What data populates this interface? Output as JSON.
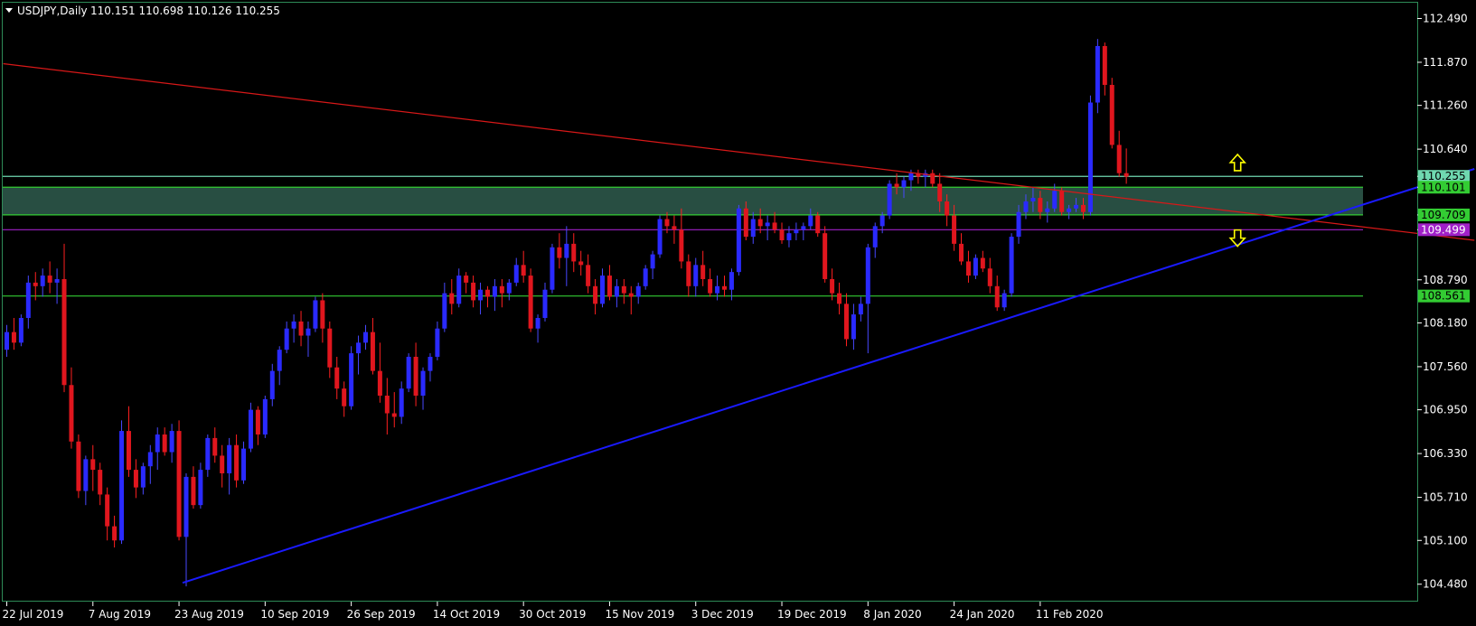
{
  "header": {
    "symbol_timeframe": "USDJPY,Daily",
    "ohlc": "110.151 110.698 110.126 110.255"
  },
  "colors": {
    "background": "#000000",
    "frame": "#2e8b57",
    "bull_candle": "#2a2aff",
    "bear_candle": "#e0161e",
    "bull_wick": "#4848ff",
    "bear_wick": "#ff2020",
    "zone_fill": "#2f5c4e",
    "support_line": "#33cc33",
    "purple_line": "#a020c8",
    "ask_line": "#6fd8b0",
    "blue_trendline": "#1a1aff",
    "red_trendline": "#d81818",
    "arrows": "#ffff00",
    "axis_text": "#ffffff"
  },
  "chart_data": {
    "type": "candlestick",
    "title": "USDJPY,Daily",
    "ylim": [
      104.24,
      112.72
    ],
    "y_ticks": [
      "112.490",
      "111.870",
      "111.260",
      "110.640",
      "110.255",
      "110.101",
      "109.709",
      "109.499",
      "108.790",
      "108.180",
      "107.560",
      "106.950",
      "106.330",
      "105.710",
      "105.100",
      "104.480"
    ],
    "x_ticks": [
      {
        "label": "22 Jul 2019",
        "index": 0
      },
      {
        "label": "7 Aug 2019",
        "index": 12
      },
      {
        "label": "23 Aug 2019",
        "index": 24
      },
      {
        "label": "10 Sep 2019",
        "index": 36
      },
      {
        "label": "26 Sep 2019",
        "index": 48
      },
      {
        "label": "14 Oct 2019",
        "index": 60
      },
      {
        "label": "30 Oct 2019",
        "index": 72
      },
      {
        "label": "15 Nov 2019",
        "index": 84
      },
      {
        "label": "3 Dec 2019",
        "index": 96
      },
      {
        "label": "19 Dec 2019",
        "index": 108
      },
      {
        "label": "8 Jan 2020",
        "index": 120
      },
      {
        "label": "24 Jan 2020",
        "index": 132
      },
      {
        "label": "11 Feb 2020",
        "index": 144
      }
    ],
    "price_labels": [
      {
        "text": "110.255",
        "value": 110.255,
        "color": "#6fd8b0",
        "text_color": "#000000"
      },
      {
        "text": "110.101",
        "value": 110.101,
        "color": "#33cc33",
        "text_color": "#000000"
      },
      {
        "text": "109.709",
        "value": 109.709,
        "color": "#33cc33",
        "text_color": "#000000"
      },
      {
        "text": "109.499",
        "value": 109.499,
        "color": "#a020c8",
        "text_color": "#ffffff"
      },
      {
        "text": "108.561",
        "value": 108.561,
        "color": "#33cc33",
        "text_color": "#000000"
      }
    ],
    "zone": {
      "top": 110.101,
      "bottom": 109.709
    },
    "horizontal_lines": [
      {
        "value": 110.255,
        "color": "#6fd8b0"
      },
      {
        "value": 110.101,
        "color": "#33cc33"
      },
      {
        "value": 109.709,
        "color": "#33cc33"
      },
      {
        "value": 109.499,
        "color": "#a020c8"
      },
      {
        "value": 108.561,
        "color": "#33cc33"
      }
    ],
    "trendlines": [
      {
        "name": "",
        "color": "#d81818",
        "p1": {
          "index": -0.5,
          "price": 111.85
        },
        "p2": {
          "index": 204.5,
          "price": 109.35
        }
      },
      {
        "name": "",
        "color": "#1a1aff",
        "p1": {
          "index": 24.5,
          "price": 104.5
        },
        "p2": {
          "index": 204.5,
          "price": 110.36
        }
      }
    ],
    "arrows": [
      {
        "direction": "up",
        "index": 171.5,
        "price": 110.45
      },
      {
        "direction": "down",
        "index": 171.5,
        "price": 109.38
      }
    ],
    "candles": [
      [
        107.8,
        108.15,
        107.7,
        108.05
      ],
      [
        108.05,
        108.25,
        107.8,
        107.9
      ],
      [
        107.9,
        108.3,
        107.85,
        108.25
      ],
      [
        108.25,
        108.85,
        108.1,
        108.75
      ],
      [
        108.75,
        108.9,
        108.5,
        108.7
      ],
      [
        108.7,
        108.95,
        108.55,
        108.85
      ],
      [
        108.85,
        109.05,
        108.6,
        108.75
      ],
      [
        108.75,
        108.95,
        108.45,
        108.8
      ],
      [
        108.8,
        109.3,
        107.2,
        107.3
      ],
      [
        107.3,
        107.55,
        106.4,
        106.5
      ],
      [
        106.5,
        106.6,
        105.7,
        105.8
      ],
      [
        105.8,
        106.3,
        105.6,
        106.25
      ],
      [
        106.25,
        106.45,
        105.8,
        106.1
      ],
      [
        106.1,
        106.2,
        105.6,
        105.75
      ],
      [
        105.75,
        105.85,
        105.1,
        105.3
      ],
      [
        105.3,
        105.45,
        105.0,
        105.1
      ],
      [
        105.1,
        106.8,
        105.05,
        106.65
      ],
      [
        106.65,
        107.0,
        106.0,
        106.1
      ],
      [
        106.1,
        106.25,
        105.7,
        105.85
      ],
      [
        105.85,
        106.2,
        105.75,
        106.15
      ],
      [
        106.15,
        106.45,
        105.9,
        106.35
      ],
      [
        106.35,
        106.7,
        106.1,
        106.6
      ],
      [
        106.6,
        106.7,
        106.3,
        106.35
      ],
      [
        106.35,
        106.75,
        106.2,
        106.65
      ],
      [
        106.65,
        106.8,
        105.1,
        105.15
      ],
      [
        105.15,
        106.05,
        104.45,
        106.0
      ],
      [
        106.0,
        106.15,
        105.55,
        105.6
      ],
      [
        105.6,
        106.2,
        105.55,
        106.1
      ],
      [
        106.1,
        106.6,
        106.0,
        106.55
      ],
      [
        106.55,
        106.7,
        106.2,
        106.3
      ],
      [
        106.3,
        106.45,
        105.85,
        106.05
      ],
      [
        106.05,
        106.55,
        105.75,
        106.45
      ],
      [
        106.45,
        106.6,
        105.85,
        105.95
      ],
      [
        105.95,
        106.5,
        105.9,
        106.4
      ],
      [
        106.4,
        107.05,
        106.35,
        106.95
      ],
      [
        106.95,
        107.0,
        106.45,
        106.6
      ],
      [
        106.6,
        107.15,
        106.55,
        107.1
      ],
      [
        107.1,
        107.6,
        107.0,
        107.5
      ],
      [
        107.5,
        107.85,
        107.3,
        107.8
      ],
      [
        107.8,
        108.2,
        107.75,
        108.1
      ],
      [
        108.1,
        108.3,
        107.9,
        108.2
      ],
      [
        108.2,
        108.35,
        107.85,
        108.0
      ],
      [
        108.0,
        108.2,
        107.7,
        108.1
      ],
      [
        108.1,
        108.55,
        108.05,
        108.5
      ],
      [
        108.5,
        108.6,
        107.9,
        108.1
      ],
      [
        108.1,
        108.2,
        107.4,
        107.55
      ],
      [
        107.55,
        107.7,
        107.1,
        107.25
      ],
      [
        107.25,
        107.35,
        106.85,
        107.0
      ],
      [
        107.0,
        107.85,
        106.95,
        107.75
      ],
      [
        107.75,
        108.0,
        107.45,
        107.9
      ],
      [
        107.9,
        108.15,
        107.8,
        108.05
      ],
      [
        108.05,
        108.25,
        107.45,
        107.5
      ],
      [
        107.5,
        107.9,
        107.05,
        107.15
      ],
      [
        107.15,
        107.4,
        106.6,
        106.9
      ],
      [
        106.9,
        107.2,
        106.7,
        106.85
      ],
      [
        106.85,
        107.35,
        106.75,
        107.25
      ],
      [
        107.25,
        107.75,
        107.2,
        107.7
      ],
      [
        107.7,
        107.9,
        107.0,
        107.15
      ],
      [
        107.15,
        107.55,
        106.95,
        107.5
      ],
      [
        107.5,
        107.75,
        107.35,
        107.7
      ],
      [
        107.7,
        108.2,
        107.65,
        108.1
      ],
      [
        108.1,
        108.75,
        108.05,
        108.6
      ],
      [
        108.6,
        108.8,
        108.3,
        108.45
      ],
      [
        108.45,
        108.95,
        108.4,
        108.85
      ],
      [
        108.85,
        108.9,
        108.6,
        108.75
      ],
      [
        108.75,
        108.85,
        108.4,
        108.5
      ],
      [
        108.5,
        108.75,
        108.3,
        108.65
      ],
      [
        108.65,
        108.7,
        108.4,
        108.55
      ],
      [
        108.55,
        108.8,
        108.35,
        108.7
      ],
      [
        108.7,
        108.8,
        108.4,
        108.6
      ],
      [
        108.6,
        108.8,
        108.5,
        108.75
      ],
      [
        108.75,
        109.1,
        108.7,
        109.0
      ],
      [
        109.0,
        109.2,
        108.75,
        108.85
      ],
      [
        108.85,
        108.95,
        108.05,
        108.1
      ],
      [
        108.1,
        108.3,
        107.9,
        108.25
      ],
      [
        108.25,
        108.75,
        108.2,
        108.65
      ],
      [
        108.65,
        109.3,
        108.6,
        109.25
      ],
      [
        109.25,
        109.45,
        108.95,
        109.1
      ],
      [
        109.1,
        109.55,
        108.7,
        109.3
      ],
      [
        109.3,
        109.45,
        108.9,
        109.05
      ],
      [
        109.05,
        109.2,
        108.85,
        109.0
      ],
      [
        109.0,
        109.15,
        108.6,
        108.7
      ],
      [
        108.7,
        108.8,
        108.3,
        108.45
      ],
      [
        108.45,
        108.95,
        108.4,
        108.85
      ],
      [
        108.85,
        109.0,
        108.5,
        108.55
      ],
      [
        108.55,
        108.8,
        108.4,
        108.7
      ],
      [
        108.7,
        108.8,
        108.45,
        108.6
      ],
      [
        108.6,
        108.7,
        108.3,
        108.55
      ],
      [
        108.55,
        108.75,
        108.45,
        108.7
      ],
      [
        108.7,
        109.0,
        108.65,
        108.95
      ],
      [
        108.95,
        109.2,
        108.8,
        109.15
      ],
      [
        109.15,
        109.7,
        109.1,
        109.65
      ],
      [
        109.65,
        109.75,
        109.45,
        109.55
      ],
      [
        109.55,
        109.7,
        109.3,
        109.5
      ],
      [
        109.5,
        109.8,
        108.95,
        109.05
      ],
      [
        109.05,
        109.15,
        108.55,
        108.7
      ],
      [
        108.7,
        109.1,
        108.55,
        109.0
      ],
      [
        109.0,
        109.2,
        108.7,
        108.8
      ],
      [
        108.8,
        108.95,
        108.55,
        108.6
      ],
      [
        108.6,
        108.85,
        108.5,
        108.7
      ],
      [
        108.7,
        108.85,
        108.55,
        108.65
      ],
      [
        108.65,
        108.95,
        108.5,
        108.9
      ],
      [
        108.9,
        109.85,
        108.85,
        109.8
      ],
      [
        109.8,
        109.9,
        109.35,
        109.4
      ],
      [
        109.4,
        109.75,
        109.3,
        109.65
      ],
      [
        109.65,
        109.8,
        109.45,
        109.55
      ],
      [
        109.55,
        109.7,
        109.35,
        109.6
      ],
      [
        109.6,
        109.75,
        109.45,
        109.5
      ],
      [
        109.5,
        109.6,
        109.3,
        109.35
      ],
      [
        109.35,
        109.55,
        109.25,
        109.45
      ],
      [
        109.45,
        109.6,
        109.35,
        109.5
      ],
      [
        109.5,
        109.6,
        109.35,
        109.55
      ],
      [
        109.55,
        109.8,
        109.5,
        109.7
      ],
      [
        109.7,
        109.75,
        109.4,
        109.45
      ],
      [
        109.45,
        109.55,
        108.75,
        108.8
      ],
      [
        108.8,
        108.95,
        108.5,
        108.6
      ],
      [
        108.6,
        108.75,
        108.3,
        108.45
      ],
      [
        108.45,
        108.6,
        107.85,
        107.95
      ],
      [
        107.95,
        108.45,
        107.8,
        108.3
      ],
      [
        108.3,
        108.55,
        108.2,
        108.45
      ],
      [
        108.45,
        109.3,
        107.75,
        109.25
      ],
      [
        109.25,
        109.6,
        109.1,
        109.55
      ],
      [
        109.55,
        109.75,
        109.45,
        109.7
      ],
      [
        109.7,
        110.2,
        109.65,
        110.15
      ],
      [
        110.15,
        110.3,
        110.0,
        110.1
      ],
      [
        110.1,
        110.25,
        109.95,
        110.2
      ],
      [
        110.2,
        110.35,
        110.05,
        110.3
      ],
      [
        110.3,
        110.35,
        110.15,
        110.25
      ],
      [
        110.25,
        110.35,
        110.1,
        110.3
      ],
      [
        110.3,
        110.35,
        110.1,
        110.15
      ],
      [
        110.15,
        110.3,
        109.75,
        109.9
      ],
      [
        109.9,
        110.0,
        109.55,
        109.7
      ],
      [
        109.7,
        109.85,
        109.2,
        109.3
      ],
      [
        109.3,
        109.45,
        109.0,
        109.05
      ],
      [
        109.05,
        109.2,
        108.75,
        108.85
      ],
      [
        108.85,
        109.15,
        108.8,
        109.1
      ],
      [
        109.1,
        109.2,
        108.9,
        108.95
      ],
      [
        108.95,
        109.1,
        108.6,
        108.7
      ],
      [
        108.7,
        108.85,
        108.35,
        108.4
      ],
      [
        108.4,
        108.65,
        108.35,
        108.6
      ],
      [
        108.6,
        109.45,
        108.55,
        109.4
      ],
      [
        109.4,
        109.85,
        109.3,
        109.75
      ],
      [
        109.75,
        110.0,
        109.65,
        109.9
      ],
      [
        109.9,
        110.1,
        109.75,
        109.95
      ],
      [
        109.95,
        110.05,
        109.65,
        109.75
      ],
      [
        109.75,
        109.9,
        109.6,
        109.8
      ],
      [
        109.8,
        110.15,
        109.75,
        110.05
      ],
      [
        110.05,
        110.1,
        109.7,
        109.75
      ],
      [
        109.75,
        109.85,
        109.65,
        109.8
      ],
      [
        109.8,
        109.95,
        109.75,
        109.85
      ],
      [
        109.85,
        109.95,
        109.65,
        109.75
      ],
      [
        109.75,
        111.4,
        109.7,
        111.3
      ],
      [
        111.3,
        112.2,
        111.15,
        112.1
      ],
      [
        112.1,
        112.15,
        111.4,
        111.55
      ],
      [
        111.55,
        111.65,
        110.65,
        110.7
      ],
      [
        110.7,
        110.9,
        110.25,
        110.3
      ],
      [
        110.3,
        110.65,
        110.15,
        110.25
      ]
    ]
  }
}
